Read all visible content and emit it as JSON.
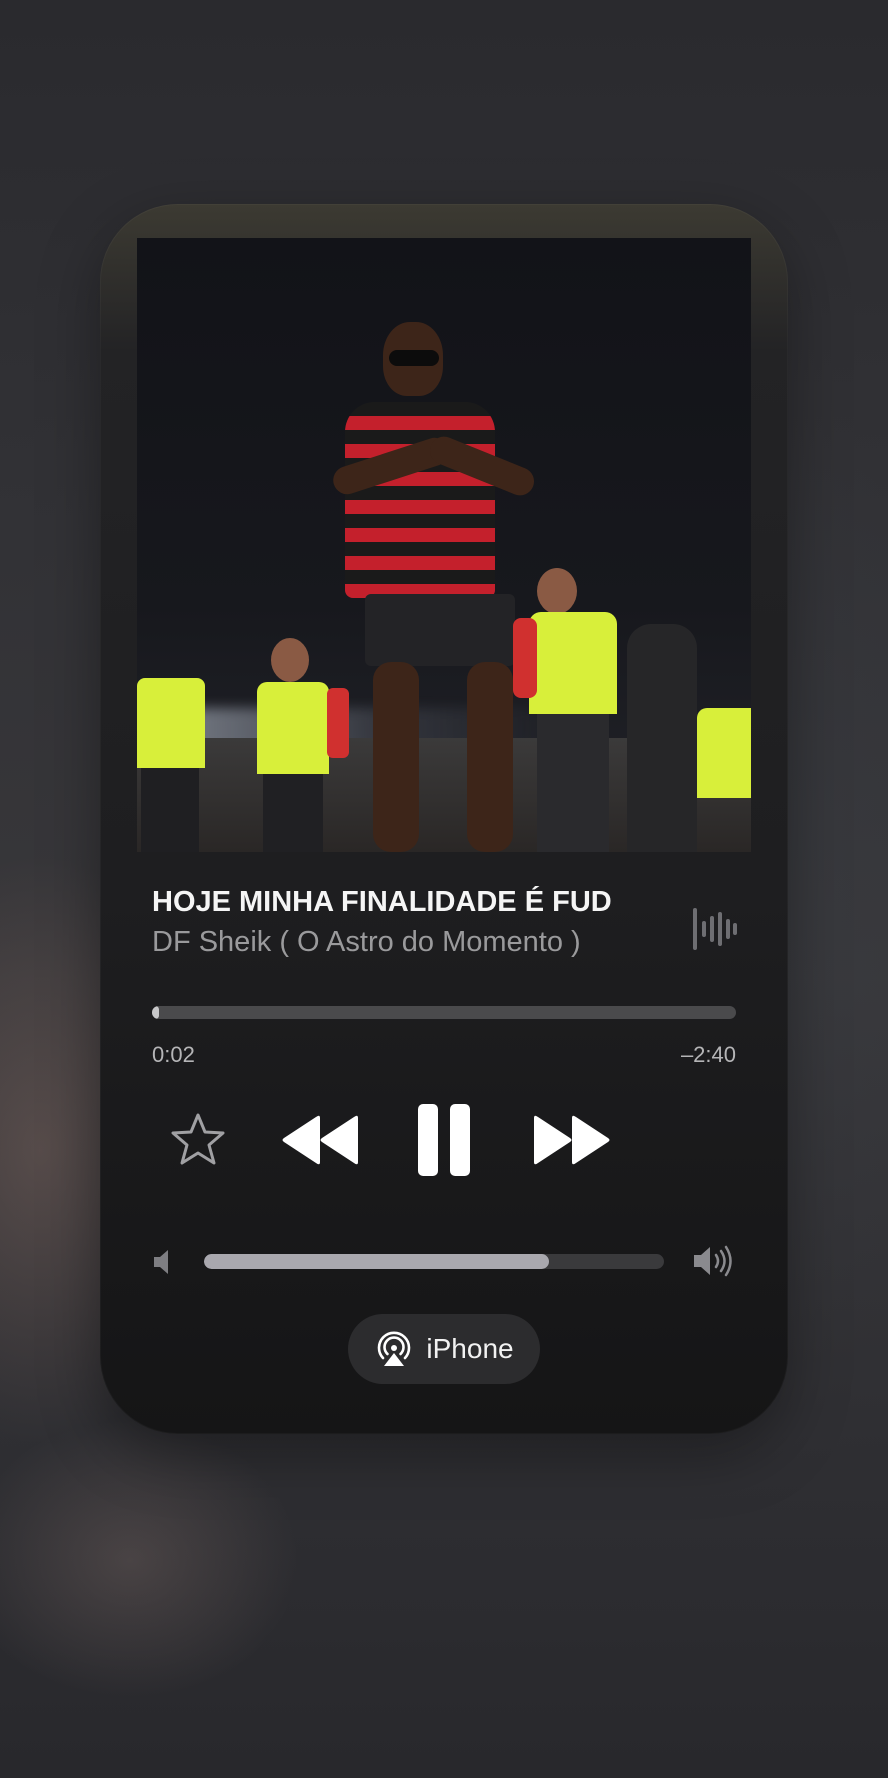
{
  "now_playing": {
    "title": "HOJE MINHA FINALIDADE É FUD",
    "artist": "DF Sheik ( O Astro do Momento )",
    "progress_fraction": 0.01,
    "elapsed": "0:02",
    "remaining": "–2:40"
  },
  "controls": {
    "favorite_icon": "star-icon",
    "rewind_icon": "rewind-icon",
    "pause_icon": "pause-icon",
    "forward_icon": "fast-forward-icon",
    "waveform_icon": "waveform-icon"
  },
  "volume": {
    "level_fraction": 0.75,
    "low_icon": "speaker-low-icon",
    "high_icon": "speaker-high-icon"
  },
  "airplay": {
    "icon": "airplay-icon",
    "label": "iPhone"
  },
  "colors": {
    "accent": "#ffffff",
    "secondary_text": "#9a9a9c",
    "card_background": "#1e1e20"
  }
}
